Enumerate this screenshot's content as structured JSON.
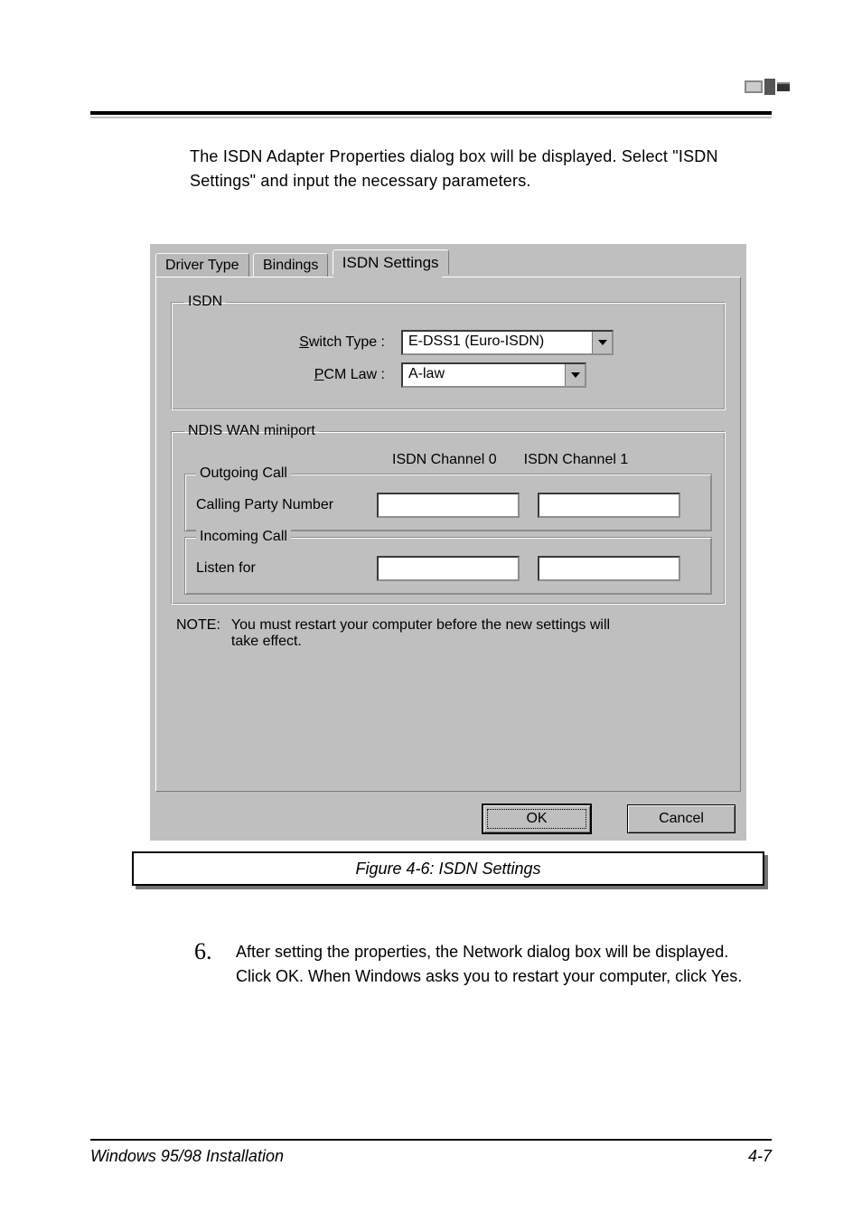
{
  "intro": "The ISDN Adapter Properties dialog box will be displayed. Select \"ISDN Settings\" and input the necessary parameters.",
  "dialog": {
    "tabs": {
      "driver": "Driver Type",
      "bindings": "Bindings",
      "isdn": "ISDN Settings"
    },
    "isdn_group": {
      "legend": "ISDN",
      "switch_label_pre": "S",
      "switch_label_rest": "witch Type :",
      "switch_value": "E-DSS1 (Euro-ISDN)",
      "pcm_label_pre": "P",
      "pcm_label_rest": "CM Law :",
      "pcm_value": "A-law"
    },
    "miniport": {
      "legend": "NDIS WAN miniport",
      "col0": "ISDN Channel 0",
      "col1": "ISDN Channel 1",
      "outgoing_legend": "Outgoing Call",
      "outgoing_caption": "Calling Party Number",
      "incoming_legend": "Incoming Call",
      "incoming_caption": "Listen for",
      "out0": "",
      "out1": "",
      "in0": "",
      "in1": ""
    },
    "note_key": "NOTE:",
    "note_val": "You must restart your computer before the new settings will take effect.",
    "ok": "OK",
    "cancel": "Cancel"
  },
  "figure_caption": "Figure 4-6: ISDN Settings",
  "step6_num": "6.",
  "step6_body": "After setting the properties, the Network dialog box will be displayed. Click OK. When Windows asks you to restart your computer, click Yes.",
  "footer_title": "Windows 95/98 Installation",
  "footer_page": "4-7"
}
